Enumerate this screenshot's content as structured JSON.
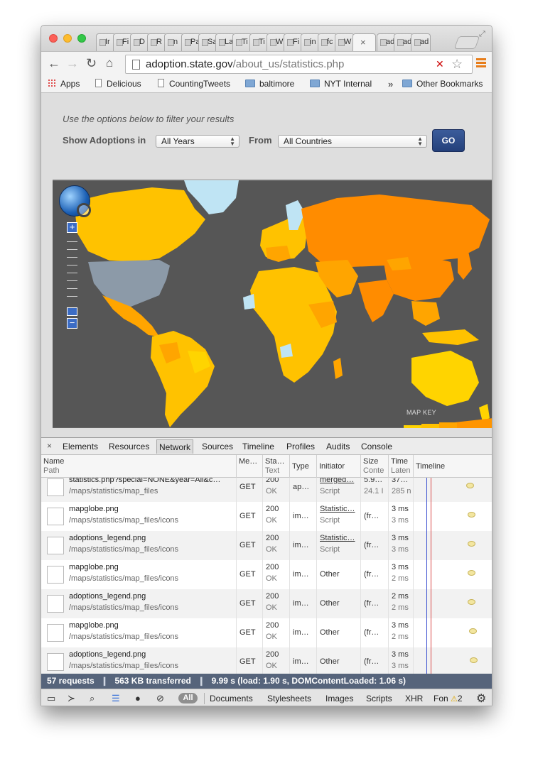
{
  "browser": {
    "tabs": [
      {
        "label": "Ir"
      },
      {
        "label": "Fi"
      },
      {
        "label": "D"
      },
      {
        "label": "R"
      },
      {
        "label": "n"
      },
      {
        "label": "Pa"
      },
      {
        "label": "Sa"
      },
      {
        "label": "La"
      },
      {
        "label": "Ti"
      },
      {
        "label": "Ti"
      },
      {
        "label": "W"
      },
      {
        "label": "Fi"
      },
      {
        "label": "in"
      },
      {
        "label": "fc"
      },
      {
        "label": "W"
      },
      {
        "label": "ad"
      },
      {
        "label": "ad"
      },
      {
        "label": "ad"
      }
    ],
    "active_tab_close": "×",
    "url_domain": "adoption.state.gov",
    "url_path": "/about_us/statistics.php"
  },
  "bookmarks": {
    "apps": "Apps",
    "items": [
      "Delicious",
      "CountingTweets",
      "baltimore",
      "NYT Internal"
    ],
    "more": "»",
    "other": "Other Bookmarks"
  },
  "page": {
    "hint": "Use the options below to filter your results",
    "show_label": "Show Adoptions in",
    "years_value": "All Years",
    "from_label": "From",
    "countries_value": "All Countries",
    "go_label": "GO",
    "map_key_label": "MAP KEY",
    "map_colors": {
      "ocean": "#565656",
      "high": "#ff8c00",
      "mid": "#ffa500",
      "low": "#ffc200",
      "lowest": "#ffd400",
      "none": "#bfe4f4",
      "usa": "#8c9aa8"
    }
  },
  "devtools": {
    "close": "×",
    "tabs": [
      "Elements",
      "Resources",
      "Network",
      "Sources",
      "Timeline",
      "Profiles",
      "Audits",
      "Console"
    ],
    "headers": [
      {
        "l1": "Name",
        "l2": "Path"
      },
      {
        "l1": "Me…",
        "l2": ""
      },
      {
        "l1": "Sta…",
        "l2": "Text"
      },
      {
        "l1": "Type",
        "l2": ""
      },
      {
        "l1": "Initiator",
        "l2": ""
      },
      {
        "l1": "Size",
        "l2": "Conte"
      },
      {
        "l1": "Time",
        "l2": "Laten"
      },
      {
        "l1": "Timeline",
        "l2": ""
      }
    ],
    "rows": [
      {
        "name": "statistics.php?special=NONE&year=All&c…",
        "path": "/maps/statistics/map_files",
        "method": "GET",
        "status": "200",
        "status_text": "OK",
        "type": "ap…",
        "initiator": "merged…",
        "initiator_sub": "Script",
        "size": "5.9…",
        "size_sub": "24.1 I",
        "time": "37…",
        "time_sub": "285 n"
      },
      {
        "name": "mapglobe.png",
        "path": "/maps/statistics/map_files/icons",
        "method": "GET",
        "status": "200",
        "status_text": "OK",
        "type": "im…",
        "initiator": "Statistic…",
        "initiator_sub": "Script",
        "size": "(fr…",
        "size_sub": "",
        "time": "3 ms",
        "time_sub": "3 ms"
      },
      {
        "name": "adoptions_legend.png",
        "path": "/maps/statistics/map_files/icons",
        "method": "GET",
        "status": "200",
        "status_text": "OK",
        "type": "im…",
        "initiator": "Statistic…",
        "initiator_sub": "Script",
        "size": "(fr…",
        "size_sub": "",
        "time": "3 ms",
        "time_sub": "3 ms"
      },
      {
        "name": "mapglobe.png",
        "path": "/maps/statistics/map_files/icons",
        "method": "GET",
        "status": "200",
        "status_text": "OK",
        "type": "im…",
        "initiator": "Other",
        "initiator_sub": "",
        "size": "(fr…",
        "size_sub": "",
        "time": "3 ms",
        "time_sub": "2 ms"
      },
      {
        "name": "adoptions_legend.png",
        "path": "/maps/statistics/map_files/icons",
        "method": "GET",
        "status": "200",
        "status_text": "OK",
        "type": "im…",
        "initiator": "Other",
        "initiator_sub": "",
        "size": "(fr…",
        "size_sub": "",
        "time": "2 ms",
        "time_sub": "2 ms"
      },
      {
        "name": "mapglobe.png",
        "path": "/maps/statistics/map_files/icons",
        "method": "GET",
        "status": "200",
        "status_text": "OK",
        "type": "im…",
        "initiator": "Other",
        "initiator_sub": "",
        "size": "(fr…",
        "size_sub": "",
        "time": "3 ms",
        "time_sub": "2 ms"
      },
      {
        "name": "adoptions_legend.png",
        "path": "/maps/statistics/map_files/icons",
        "method": "GET",
        "status": "200",
        "status_text": "OK",
        "type": "im…",
        "initiator": "Other",
        "initiator_sub": "",
        "size": "(fr…",
        "size_sub": "",
        "time": "3 ms",
        "time_sub": "3 ms"
      }
    ],
    "summary": {
      "requests": "57 requests",
      "sep1": "❙",
      "transferred": "563 KB transferred",
      "sep2": "❙",
      "timing": "9.99 s (load: 1.90 s, DOMContentLoaded: 1.06 s)"
    },
    "bottom": {
      "all": "All",
      "filters": [
        "Documents",
        "Stylesheets",
        "Images",
        "Scripts",
        "XHR",
        "Fon"
      ],
      "warning_count": "2"
    }
  }
}
